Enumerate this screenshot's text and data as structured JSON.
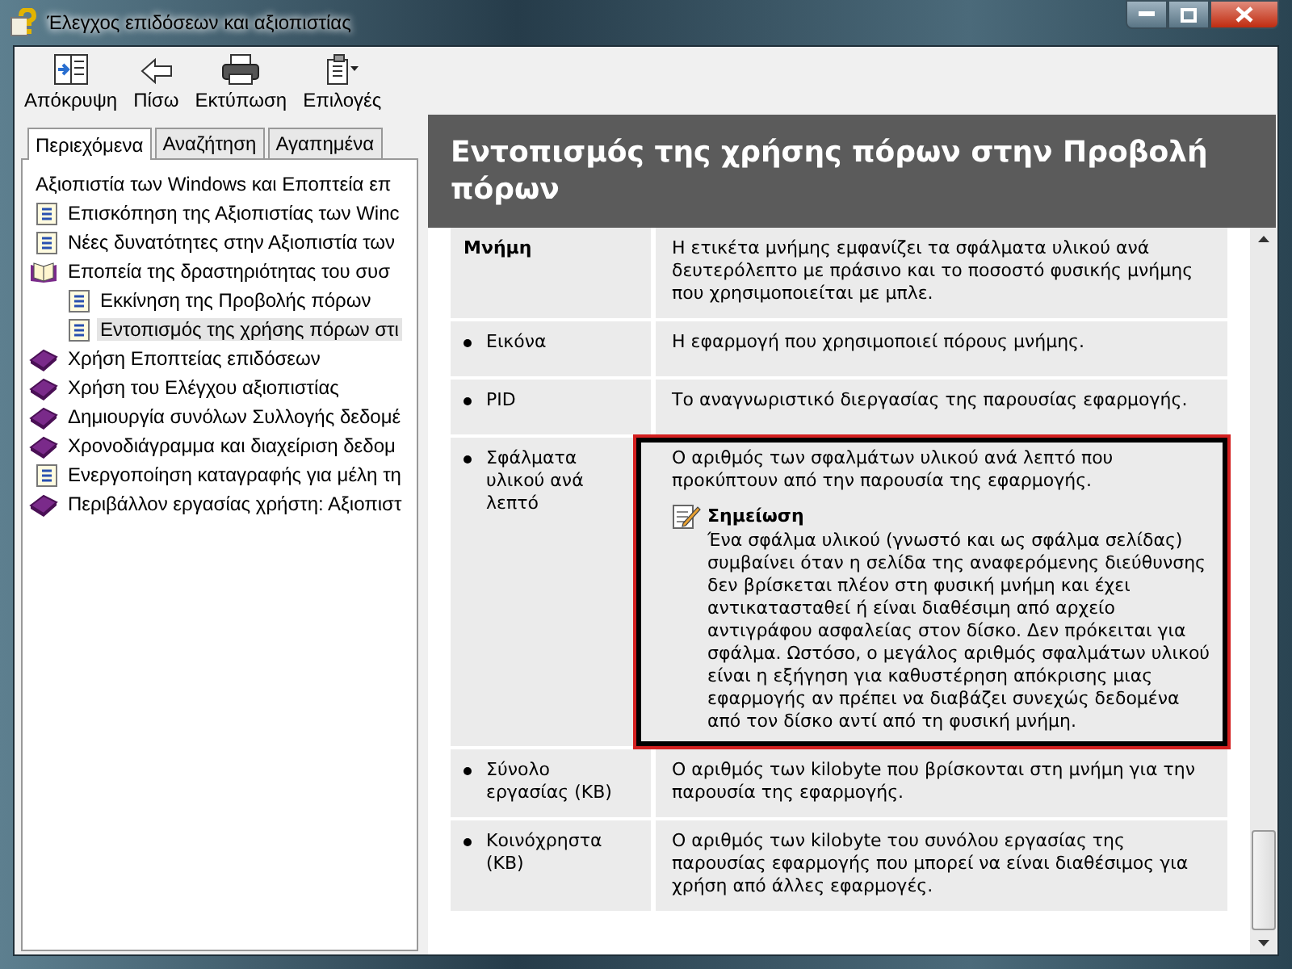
{
  "window": {
    "title": "Έλεγχος επιδόσεων και αξιοπιστίας"
  },
  "toolbar": [
    {
      "label": "Απόκρυψη",
      "kind": "hide"
    },
    {
      "label": "Πίσω",
      "kind": "back"
    },
    {
      "label": "Εκτύπωση",
      "kind": "print"
    },
    {
      "label": "Επιλογές",
      "kind": "options"
    }
  ],
  "tabs": [
    {
      "label": "Περιεχόμενα",
      "selected": true
    },
    {
      "label": "Αναζήτηση",
      "selected": false
    },
    {
      "label": "Αγαπημένα",
      "selected": false
    }
  ],
  "tree": [
    {
      "label": "Αξιοπιστία των Windows και Εποπτεία επ",
      "selected": false,
      "children": [
        {
          "label": "Επισκόπηση της Αξιοπιστίας των Winc",
          "kind": "page",
          "selected": false
        },
        {
          "label": "Νέες δυνατότητες στην Αξιοπιστία των",
          "kind": "page",
          "selected": false
        },
        {
          "label": "Εποπεία της δραστηριότητας του συσ",
          "kind": "open-book",
          "selected": false,
          "children": [
            {
              "label": "Εκκίνηση της Προβολής πόρων",
              "kind": "page",
              "selected": false
            },
            {
              "label": "Εντοπισμός της χρήσης πόρων στι",
              "kind": "page",
              "selected": true
            }
          ]
        },
        {
          "label": "Χρήση Εποπτείας επιδόσεων",
          "kind": "book",
          "selected": false
        },
        {
          "label": "Χρήση του Ελέγχου αξιοπιστίας",
          "kind": "book",
          "selected": false
        },
        {
          "label": "Δημιουργία συνόλων Συλλογής δεδομέ",
          "kind": "book",
          "selected": false
        },
        {
          "label": "Χρονοδιάγραμμα και διαχείριση δεδομ",
          "kind": "book",
          "selected": false
        },
        {
          "label": "Ενεργοποίηση καταγραφής για μέλη τη",
          "kind": "page",
          "selected": false
        },
        {
          "label": "Περιβάλλον εργασίας χρήστη: Αξιοπιστ",
          "kind": "book",
          "selected": false
        }
      ]
    }
  ],
  "article": {
    "title": "Εντοπισμός της χρήσης πόρων στην Προβολή πόρων",
    "rows": [
      {
        "kind": "heading",
        "term": "Μνήμη",
        "description": "Η ετικέτα μνήμης εμφανίζει τα σφάλματα υλικού ανά δευτερόλεπτο με πράσινο και το ποσοστό φυσικής μνήμης που χρησιμοποιείται με μπλε.",
        "highlighted": false
      },
      {
        "kind": "bullet",
        "term": "Εικόνα",
        "description": "Η εφαρμογή που χρησιμοποιεί πόρους μνήμης.",
        "highlighted": false
      },
      {
        "kind": "bullet",
        "term": "PID",
        "description": "Το αναγνωριστικό διεργασίας της παρουσίας εφαρμογής.",
        "highlighted": false
      },
      {
        "kind": "bullet",
        "term": "Σφάλματα υλικού ανά λεπτό",
        "description": "Ο αριθμός των σφαλμάτων υλικού ανά λεπτό που προκύπτουν από την παρουσία της εφαρμογής.",
        "highlighted": true,
        "note": {
          "title": "Σημείωση",
          "text": "Ένα σφάλμα υλικού (γνωστό και ως σφάλμα σελίδας) συμβαίνει όταν η σελίδα της αναφερόμενης διεύθυνσης δεν βρίσκεται πλέον στη φυσική μνήμη και έχει αντικατασταθεί ή είναι διαθέσιμη από αρχείο αντιγράφου ασφαλείας στον δίσκο. Δεν πρόκειται για σφάλμα. Ωστόσο, ο μεγάλος αριθμός σφαλμάτων υλικού είναι η εξήγηση για καθυστέρηση απόκρισης μιας εφαρμογής αν πρέπει να διαβάζει συνεχώς δεδομένα από τον δίσκο αντί από τη φυσική μνήμη."
        }
      },
      {
        "kind": "bullet",
        "term": "Σύνολο εργασίας (KB)",
        "description": "Ο αριθμός των kilobyte που βρίσκονται στη μνήμη για την παρουσία της εφαρμογής.",
        "highlighted": false
      },
      {
        "kind": "bullet",
        "term": "Κοινόχρηστα (KB)",
        "description": "Ο αριθμός των kilobyte του συνόλου εργασίας της παρουσίας εφαρμογής που μπορεί να είναι διαθέσιμος για χρήση από άλλες εφαρμογές.",
        "highlighted": false
      }
    ]
  }
}
